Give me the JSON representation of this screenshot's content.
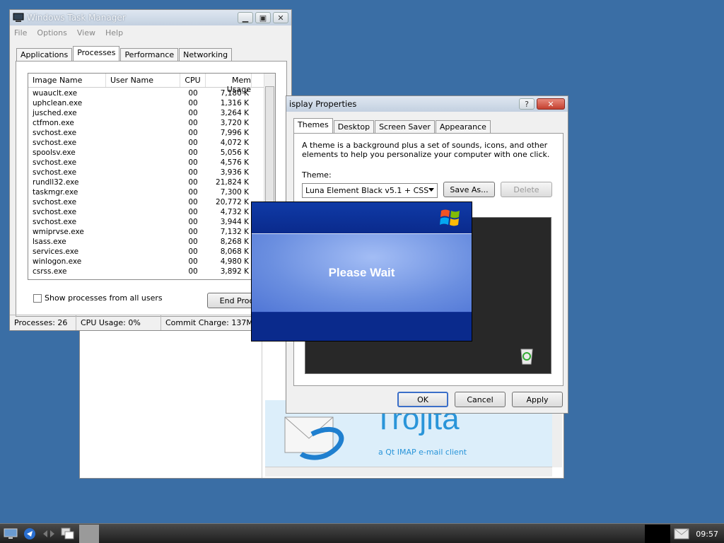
{
  "taskmgr": {
    "title": "Windows Task Manager",
    "menu": [
      "File",
      "Options",
      "View",
      "Help"
    ],
    "tabs": [
      "Applications",
      "Processes",
      "Performance",
      "Networking"
    ],
    "columns": [
      "Image Name",
      "User Name",
      "CPU",
      "Mem Usage"
    ],
    "processes": [
      {
        "name": "wuauclt.exe",
        "user": "",
        "cpu": "00",
        "mem": "7,180 K"
      },
      {
        "name": "uphclean.exe",
        "user": "",
        "cpu": "00",
        "mem": "1,316 K"
      },
      {
        "name": "jusched.exe",
        "user": "",
        "cpu": "00",
        "mem": "3,264 K"
      },
      {
        "name": "ctfmon.exe",
        "user": "",
        "cpu": "00",
        "mem": "3,720 K"
      },
      {
        "name": "svchost.exe",
        "user": "",
        "cpu": "00",
        "mem": "7,996 K"
      },
      {
        "name": "svchost.exe",
        "user": "",
        "cpu": "00",
        "mem": "4,072 K"
      },
      {
        "name": "spoolsv.exe",
        "user": "",
        "cpu": "00",
        "mem": "5,056 K"
      },
      {
        "name": "svchost.exe",
        "user": "",
        "cpu": "00",
        "mem": "4,576 K"
      },
      {
        "name": "svchost.exe",
        "user": "",
        "cpu": "00",
        "mem": "3,936 K"
      },
      {
        "name": "rundll32.exe",
        "user": "",
        "cpu": "00",
        "mem": "21,824 K"
      },
      {
        "name": "taskmgr.exe",
        "user": "",
        "cpu": "00",
        "mem": "7,300 K"
      },
      {
        "name": "svchost.exe",
        "user": "",
        "cpu": "00",
        "mem": "20,772 K"
      },
      {
        "name": "svchost.exe",
        "user": "",
        "cpu": "00",
        "mem": "4,732 K"
      },
      {
        "name": "svchost.exe",
        "user": "",
        "cpu": "00",
        "mem": "3,944 K"
      },
      {
        "name": "wmiprvse.exe",
        "user": "",
        "cpu": "00",
        "mem": "7,132 K"
      },
      {
        "name": "lsass.exe",
        "user": "",
        "cpu": "00",
        "mem": "8,268 K"
      },
      {
        "name": "services.exe",
        "user": "",
        "cpu": "00",
        "mem": "8,068 K"
      },
      {
        "name": "winlogon.exe",
        "user": "",
        "cpu": "00",
        "mem": "4,980 K"
      },
      {
        "name": "csrss.exe",
        "user": "",
        "cpu": "00",
        "mem": "3,892 K"
      }
    ],
    "show_all_label": "Show processes from all users",
    "end_process_label": "End Proce",
    "status": {
      "processes": "Processes: 26",
      "cpu": "CPU Usage: 0%",
      "commit": "Commit Charge: 137M /"
    }
  },
  "display": {
    "title": "isplay Properties",
    "tabs": [
      "Themes",
      "Desktop",
      "Screen Saver",
      "Appearance"
    ],
    "description": "A theme is a background plus a set of sounds, icons, and other elements to help you personalize your computer with one click.",
    "theme_label": "Theme:",
    "theme_value": "Luna Element Black v5.1 + CSS",
    "save_as": "Save As...",
    "delete": "Delete",
    "ok": "OK",
    "cancel": "Cancel",
    "apply": "Apply"
  },
  "please_wait": {
    "text": "Please Wait"
  },
  "trojita": {
    "name": "Trojitá",
    "tagline": "a Qt IMAP e-mail client"
  },
  "taskbar": {
    "clock": "09:57"
  }
}
